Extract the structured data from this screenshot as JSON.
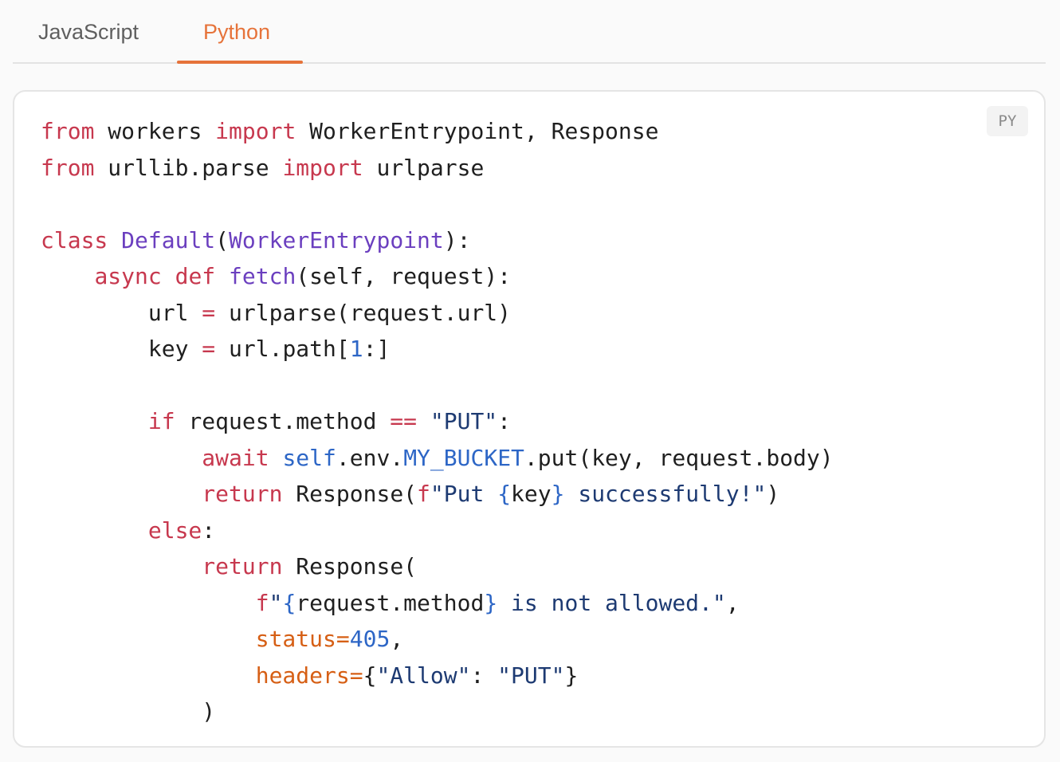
{
  "tabs": {
    "javascript": "JavaScript",
    "python": "Python",
    "active": "Python"
  },
  "code_block": {
    "language_badge": "PY",
    "lines": [
      "from workers import WorkerEntrypoint, Response",
      "from urllib.parse import urlparse",
      "",
      "class Default(WorkerEntrypoint):",
      "    async def fetch(self, request):",
      "        url = urlparse(request.url)",
      "        key = url.path[1:]",
      "",
      "        if request.method == \"PUT\":",
      "            await self.env.MY_BUCKET.put(key, request.body)",
      "            return Response(f\"Put {key} successfully!\")",
      "        else:",
      "            return Response(",
      "                f\"{request.method} is not allowed.\",",
      "                status=405,",
      "                headers={\"Allow\": \"PUT\"}",
      "            )"
    ]
  },
  "colors": {
    "accent": "#e6733a",
    "keyword": "#c7384e",
    "function": "#6b3fbf",
    "string": "#1d3a72",
    "number": "#2d66c6",
    "parameter": "#d65f15"
  }
}
